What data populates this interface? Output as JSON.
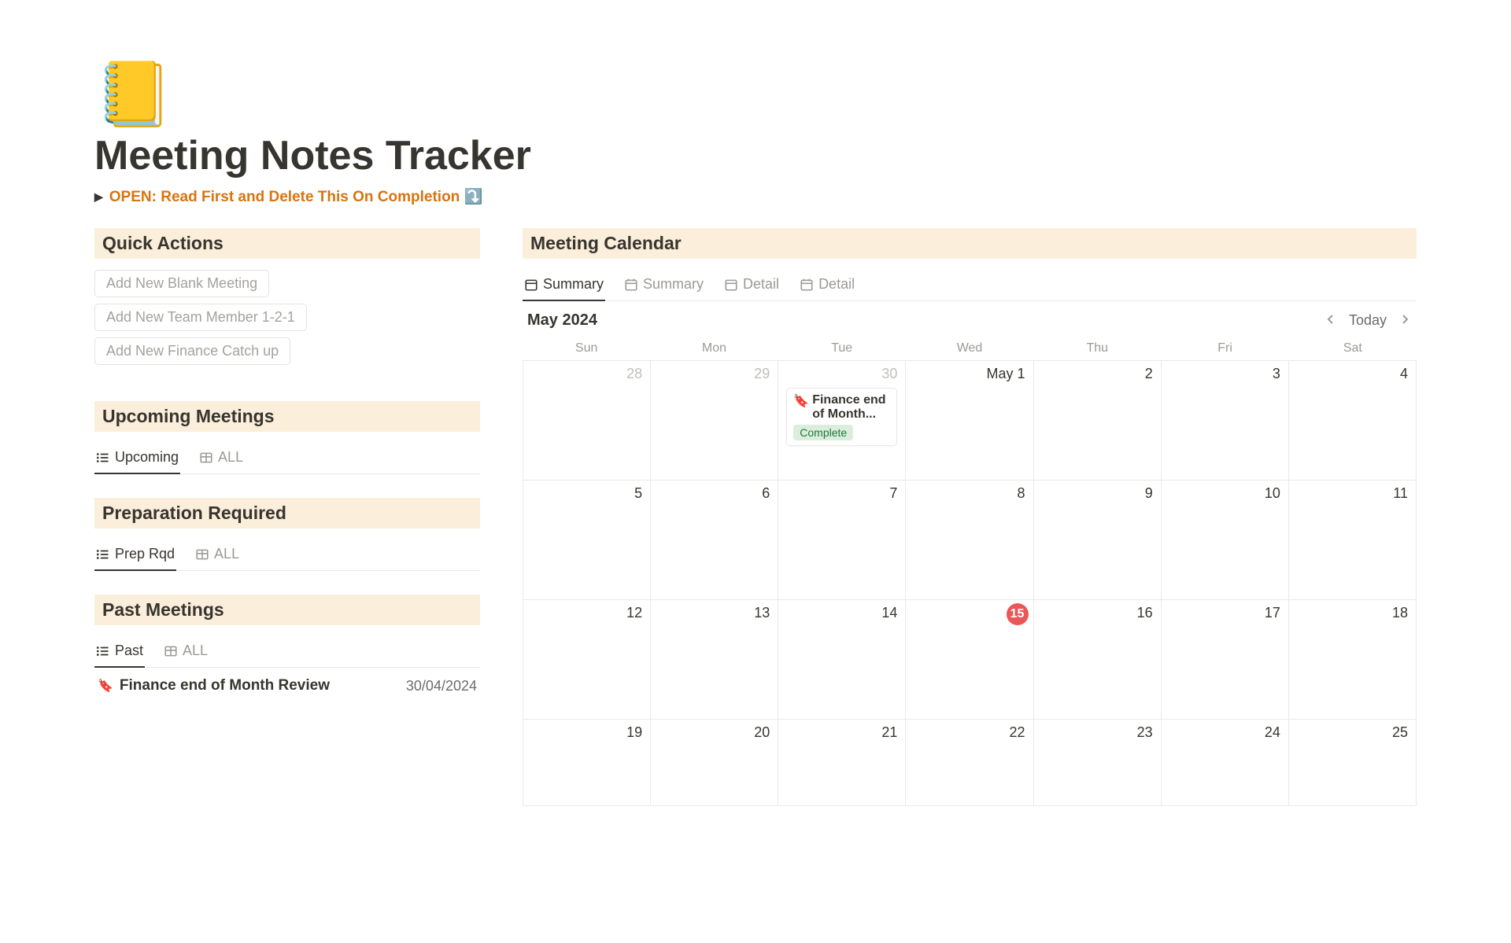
{
  "page": {
    "icon": "📒",
    "title": "Meeting Notes Tracker",
    "callout": "OPEN: Read First and Delete This On Completion ⤵️"
  },
  "sections": {
    "quick_actions": "Quick Actions",
    "upcoming": "Upcoming Meetings",
    "prep": "Preparation Required",
    "past": "Past Meetings",
    "calendar": "Meeting Calendar"
  },
  "quick_actions": {
    "blank": "Add New Blank Meeting",
    "team": "Add New Team Member 1-2-1",
    "finance": "Add New Finance Catch up"
  },
  "tabs": {
    "upcoming": {
      "a": "Upcoming",
      "b": "ALL"
    },
    "prep": {
      "a": "Prep Rqd",
      "b": "ALL"
    },
    "past": {
      "a": "Past",
      "b": "ALL"
    },
    "calendar": {
      "a": "Summary",
      "b": "Summary",
      "c": "Detail",
      "d": "Detail"
    }
  },
  "past_items": [
    {
      "icon": "🔖",
      "title": "Finance end of Month Review",
      "date": "30/04/2024"
    }
  ],
  "calendar": {
    "month_label": "May 2024",
    "today_label": "Today",
    "dow": [
      "Sun",
      "Mon",
      "Tue",
      "Wed",
      "Thu",
      "Fri",
      "Sat"
    ],
    "weeks": [
      [
        {
          "n": "28",
          "muted": true
        },
        {
          "n": "29",
          "muted": true
        },
        {
          "n": "30",
          "muted": true,
          "event": {
            "icon": "🔖",
            "title": "Finance end of Month...",
            "tag": "Complete"
          }
        },
        {
          "n": "May 1"
        },
        {
          "n": "2"
        },
        {
          "n": "3"
        },
        {
          "n": "4"
        }
      ],
      [
        {
          "n": "5"
        },
        {
          "n": "6"
        },
        {
          "n": "7"
        },
        {
          "n": "8"
        },
        {
          "n": "9"
        },
        {
          "n": "10"
        },
        {
          "n": "11"
        }
      ],
      [
        {
          "n": "12"
        },
        {
          "n": "13"
        },
        {
          "n": "14"
        },
        {
          "n": "15",
          "today": true
        },
        {
          "n": "16"
        },
        {
          "n": "17"
        },
        {
          "n": "18"
        }
      ],
      [
        {
          "n": "19"
        },
        {
          "n": "20"
        },
        {
          "n": "21"
        },
        {
          "n": "22"
        },
        {
          "n": "23"
        },
        {
          "n": "24"
        },
        {
          "n": "25"
        }
      ]
    ]
  }
}
